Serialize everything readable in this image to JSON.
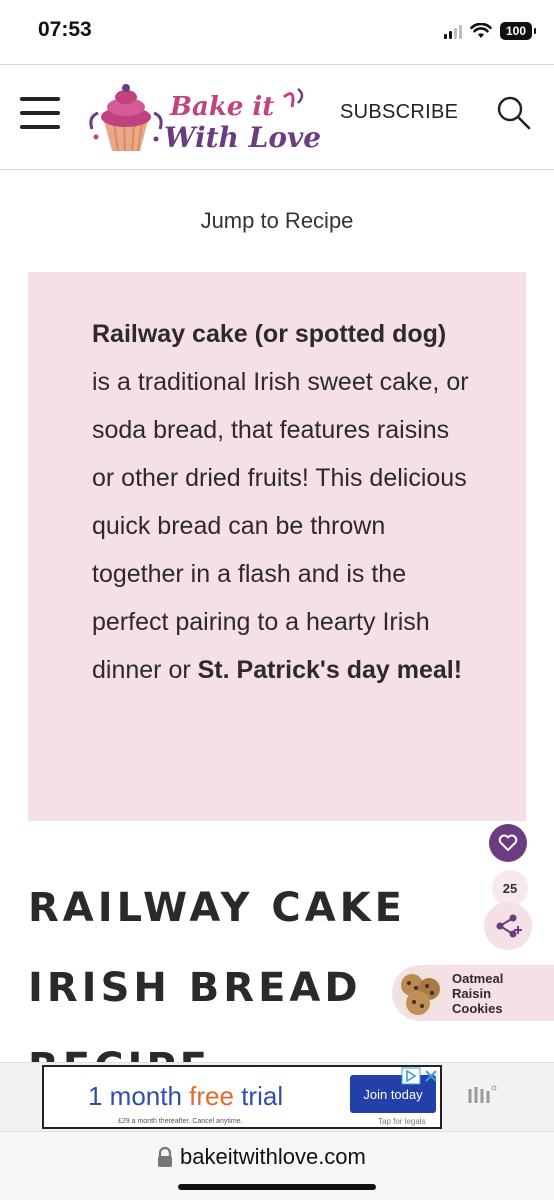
{
  "status_bar": {
    "time": "07:53",
    "battery": "100"
  },
  "header": {
    "logo_text_line1": "Bake it",
    "logo_text_line2": "With Love",
    "subscribe_label": "SUBSCRIBE"
  },
  "jump_to_recipe": "Jump to Recipe",
  "intro": {
    "bold_start": "Railway cake (or spotted dog)",
    "middle": " is a traditional Irish sweet cake, or soda bread, that features raisins or other dried fruits! This delicious quick bread can be thrown together in a flash and is the perfect pairing to a hearty Irish dinner or ",
    "bold_end": "St. Patrick's day meal!"
  },
  "article": {
    "title": "RAILWAY CAKE IRISH BREAD RECIPE"
  },
  "floating": {
    "share_count": "25"
  },
  "related": {
    "label_line1": "Oatmeal",
    "label_line2": "Raisin",
    "label_line3": "Cookies"
  },
  "ad": {
    "main_prefix": "1 month ",
    "main_free": "free",
    "main_suffix": " trial",
    "small_print": "£29 a month thereafter. Cancel anytime.",
    "join_label": "Join today",
    "legal": "Tap for legals"
  },
  "url_bar": {
    "domain": "bakeitwithlove.com"
  },
  "colors": {
    "brand_purple": "#6b3c80",
    "brand_pink": "#c2417f",
    "intro_bg": "#f4e0e5"
  }
}
